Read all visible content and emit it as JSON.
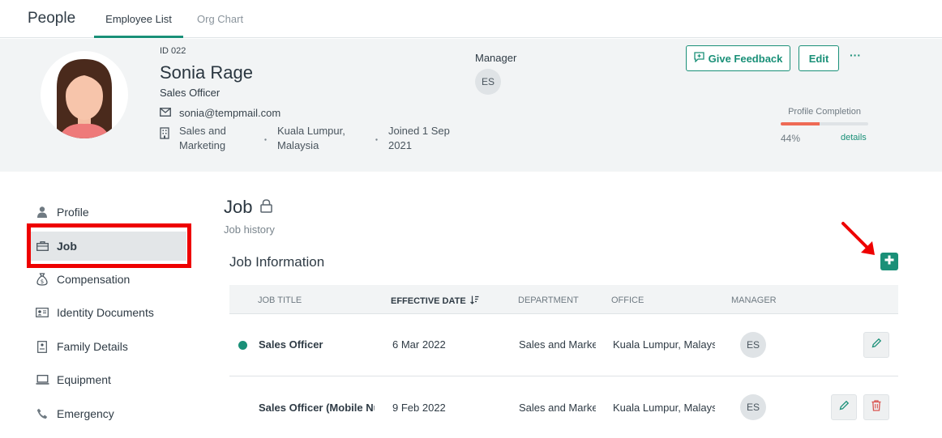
{
  "topnav": {
    "app_title": "People",
    "tabs": [
      {
        "label": "Employee List",
        "active": true
      },
      {
        "label": "Org Chart",
        "active": false
      }
    ]
  },
  "employee": {
    "id": "ID 022",
    "name": "Sonia Rage",
    "role": "Sales Officer",
    "email": "sonia@tempmail.com",
    "department": "Sales and Marketing",
    "location": "Kuala Lumpur, Malaysia",
    "joined": "Joined 1 Sep 2021",
    "manager_label": "Manager",
    "manager_initials": "ES"
  },
  "actions": {
    "give_feedback": "Give Feedback",
    "edit": "Edit",
    "more": "···"
  },
  "profile_completion": {
    "label": "Profile Completion",
    "percent_text": "44%",
    "percent": 44,
    "details": "details"
  },
  "sidebar": {
    "items": [
      {
        "label": "Profile",
        "icon": "person-icon"
      },
      {
        "label": "Job",
        "icon": "briefcase-icon",
        "active": true
      },
      {
        "label": "Compensation",
        "icon": "money-bag-icon"
      },
      {
        "label": "Identity Documents",
        "icon": "id-card-icon"
      },
      {
        "label": "Family Details",
        "icon": "document-icon"
      },
      {
        "label": "Equipment",
        "icon": "laptop-icon"
      },
      {
        "label": "Emergency",
        "icon": "phone-icon"
      }
    ]
  },
  "main": {
    "title": "Job",
    "subtitle": "Job history",
    "section_title": "Job Information",
    "columns": [
      "Job Title",
      "Effective Date",
      "Department",
      "Office",
      "Manager"
    ],
    "rows": [
      {
        "job_title": "Sales Officer",
        "effective_date": "6 Mar 2022",
        "department": "Sales and Marketing",
        "office": "Kuala Lumpur, Malaysia",
        "manager": "ES",
        "current": true
      },
      {
        "job_title": "Sales Officer (Mobile Number)",
        "effective_date": "9 Feb 2022",
        "department": "Sales and Marketing",
        "office": "Kuala Lumpur, Malaysia",
        "manager": "ES",
        "current": false
      }
    ]
  },
  "colors": {
    "accent": "#1a9078",
    "progress": "#ee6a55",
    "highlight": "#ee0000",
    "delete": "#d9534f"
  }
}
